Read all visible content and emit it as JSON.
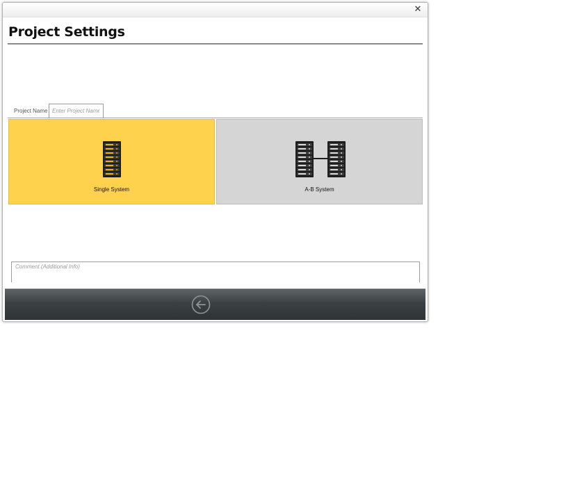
{
  "window": {
    "close_glyph": "✕"
  },
  "header": {
    "title": "Project Settings"
  },
  "project_name": {
    "label": "Project Name",
    "placeholder": "Enter Project Name",
    "value": ""
  },
  "system_options": [
    {
      "label": "Single System",
      "icon": "server-rack-icon",
      "selected": true,
      "background": "#ffd24d"
    },
    {
      "label": "A-B System",
      "icon": "linked-server-racks-icon",
      "selected": false,
      "background": "#d5d5d5"
    }
  ],
  "comment": {
    "placeholder": "Comment (Additional Info)",
    "value": ""
  },
  "footer": {
    "back_icon": "back-arrow-icon"
  },
  "colors": {
    "accent_selected": "#ffd24d",
    "tile_unselected": "#d5d5d5",
    "footer_bar": "#3b4143",
    "rack_led": "#e8b400"
  }
}
